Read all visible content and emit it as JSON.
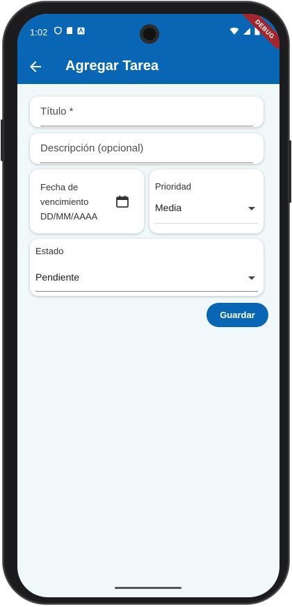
{
  "statusbar": {
    "time": "1:02",
    "debug_label": "DEBUG"
  },
  "appbar": {
    "title": "Agregar Tarea"
  },
  "form": {
    "title_field": {
      "label": "Título *"
    },
    "description_field": {
      "label": "Descripción (opcional)"
    },
    "due_date": {
      "label_line1": "Fecha de",
      "label_line2": "vencimiento",
      "placeholder": "DD/MM/AAAA"
    },
    "priority": {
      "label": "Prioridad",
      "selected": "Media"
    },
    "status": {
      "label": "Estado",
      "selected": "Pendiente"
    },
    "save_label": "Guardar"
  },
  "colors": {
    "primary": "#0866b4",
    "background": "#f1f8f9",
    "debug_ribbon": "#a4252c"
  }
}
